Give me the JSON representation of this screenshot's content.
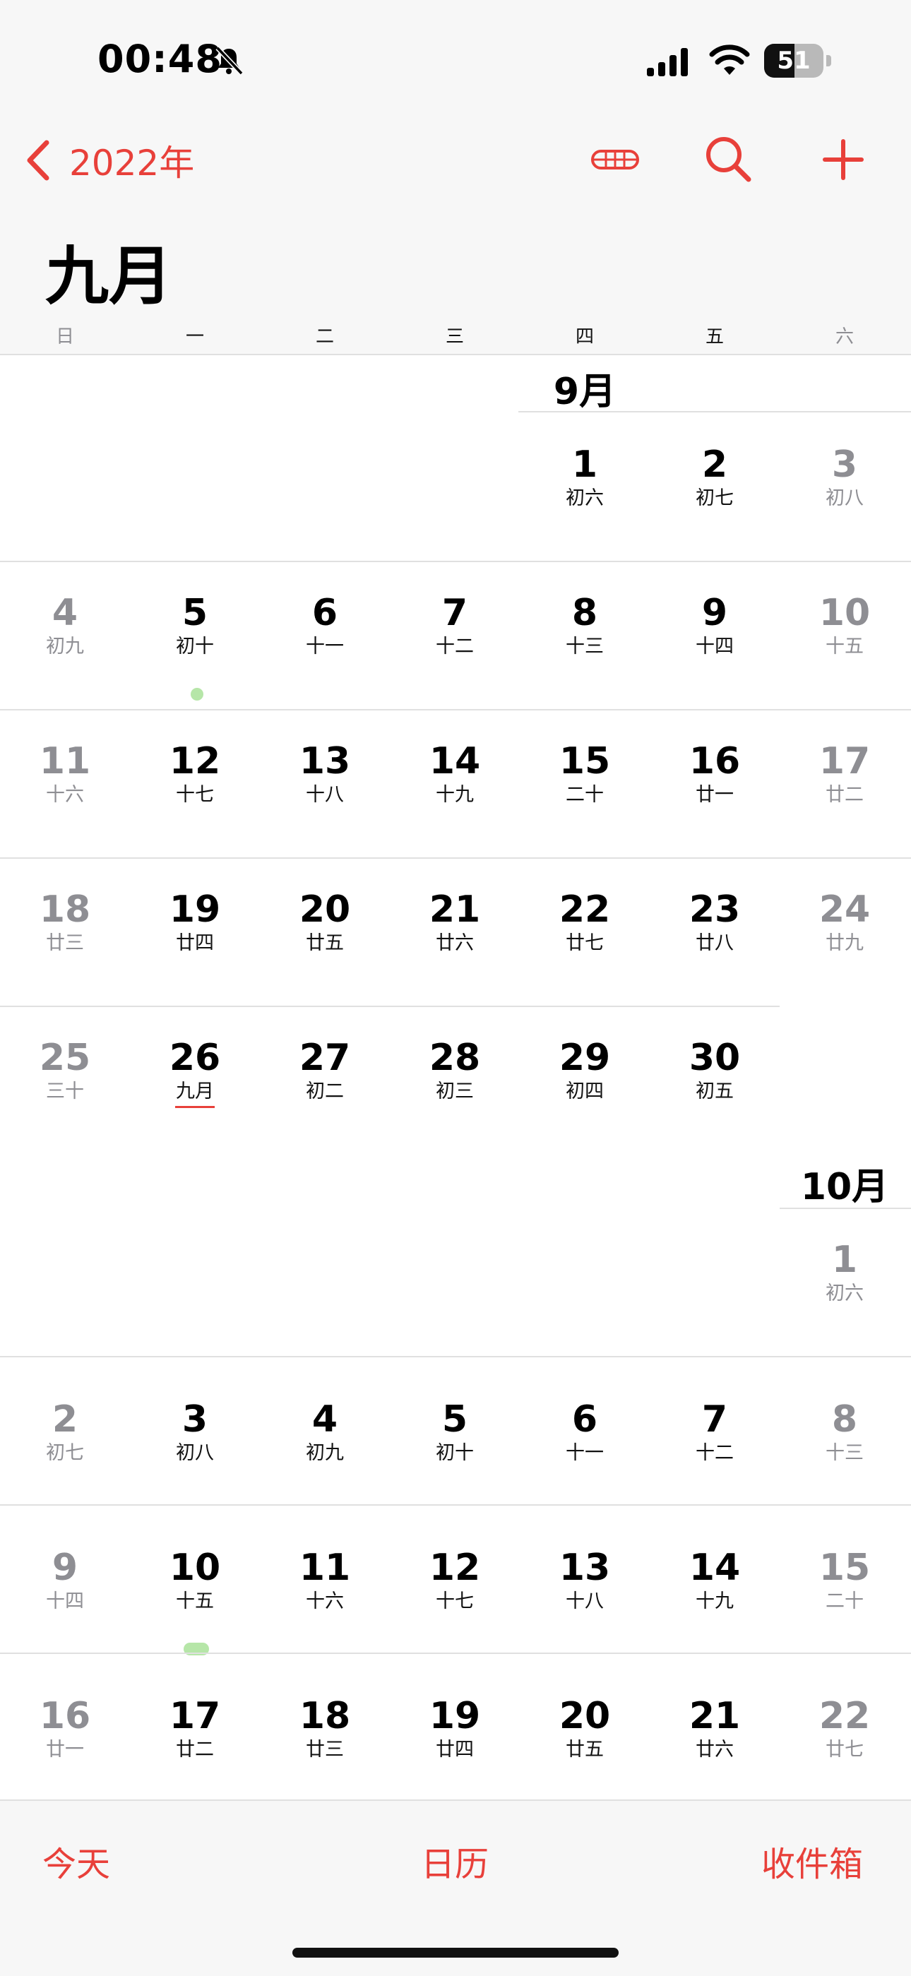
{
  "status_bar": {
    "time": "00:48",
    "battery_level": "51",
    "battery_fraction": 0.51,
    "icons": [
      "silent-bell-icon",
      "cellular-signal-icon",
      "wifi-icon",
      "battery-icon"
    ]
  },
  "nav": {
    "back_label": "2022年",
    "icons": [
      "chevron-left-icon",
      "list-view-icon",
      "search-icon",
      "add-icon"
    ]
  },
  "month_title": "九月",
  "weekdays": [
    "日",
    "一",
    "二",
    "三",
    "四",
    "五",
    "六"
  ],
  "month_labels": {
    "sep": "9月",
    "oct": "10月"
  },
  "days": [
    {
      "d": "1",
      "l": "初六"
    },
    {
      "d": "2",
      "l": "初七"
    },
    {
      "d": "3",
      "l": "初八"
    },
    {
      "d": "4",
      "l": "初九"
    },
    {
      "d": "5",
      "l": "初十"
    },
    {
      "d": "6",
      "l": "十一"
    },
    {
      "d": "7",
      "l": "十二"
    },
    {
      "d": "8",
      "l": "十三"
    },
    {
      "d": "9",
      "l": "十四"
    },
    {
      "d": "10",
      "l": "十五"
    },
    {
      "d": "11",
      "l": "十六"
    },
    {
      "d": "12",
      "l": "十七"
    },
    {
      "d": "13",
      "l": "十八"
    },
    {
      "d": "14",
      "l": "十九"
    },
    {
      "d": "15",
      "l": "二十"
    },
    {
      "d": "16",
      "l": "廿一"
    },
    {
      "d": "17",
      "l": "廿二"
    },
    {
      "d": "18",
      "l": "廿三"
    },
    {
      "d": "19",
      "l": "廿四"
    },
    {
      "d": "20",
      "l": "廿五"
    },
    {
      "d": "21",
      "l": "廿六"
    },
    {
      "d": "22",
      "l": "廿七"
    },
    {
      "d": "23",
      "l": "廿八"
    },
    {
      "d": "24",
      "l": "廿九"
    },
    {
      "d": "25",
      "l": "三十"
    },
    {
      "d": "26",
      "l": "九月"
    },
    {
      "d": "27",
      "l": "初二"
    },
    {
      "d": "28",
      "l": "初三"
    },
    {
      "d": "29",
      "l": "初四"
    },
    {
      "d": "30",
      "l": "初五"
    },
    {
      "d": "1",
      "l": "初六"
    },
    {
      "d": "2",
      "l": "初七"
    },
    {
      "d": "3",
      "l": "初八"
    },
    {
      "d": "4",
      "l": "初九"
    },
    {
      "d": "5",
      "l": "初十"
    },
    {
      "d": "6",
      "l": "十一"
    },
    {
      "d": "7",
      "l": "十二"
    },
    {
      "d": "8",
      "l": "十三"
    },
    {
      "d": "9",
      "l": "十四"
    },
    {
      "d": "10",
      "l": "十五"
    },
    {
      "d": "11",
      "l": "十六"
    },
    {
      "d": "12",
      "l": "十七"
    },
    {
      "d": "13",
      "l": "十八"
    },
    {
      "d": "14",
      "l": "十九"
    },
    {
      "d": "15",
      "l": "二十"
    },
    {
      "d": "16",
      "l": "廿一"
    },
    {
      "d": "17",
      "l": "廿二"
    },
    {
      "d": "18",
      "l": "廿三"
    },
    {
      "d": "19",
      "l": "廿四"
    },
    {
      "d": "20",
      "l": "廿五"
    },
    {
      "d": "21",
      "l": "廿六"
    },
    {
      "d": "22",
      "l": "廿七"
    }
  ],
  "tab_bar": {
    "today": "今天",
    "calendars": "日历",
    "inbox": "收件箱"
  },
  "colors": {
    "accent": "#e8403a",
    "weekend": "#8e8e93",
    "event": "#b6e6a8"
  }
}
